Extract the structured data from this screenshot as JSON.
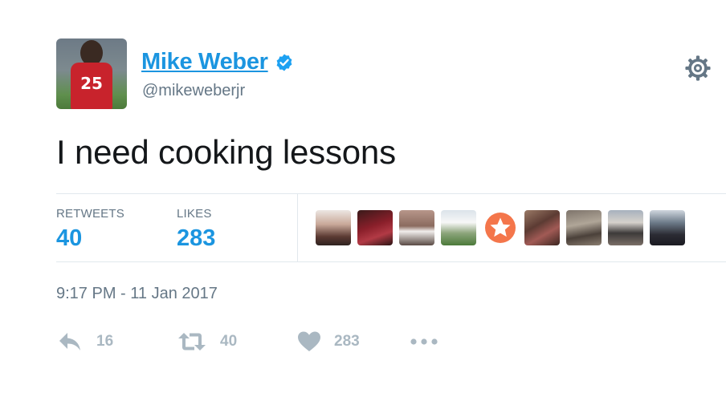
{
  "user": {
    "name": "Mike Weber",
    "handle": "@mikeweberjr",
    "avatar_jersey_number": "25",
    "verified": true
  },
  "tweet": {
    "text": "I need cooking lessons",
    "timestamp": "9:17 PM - 11 Jan 2017"
  },
  "stats": {
    "retweets_label": "RETWEETS",
    "retweets_count": "40",
    "likes_label": "LIKES",
    "likes_count": "283"
  },
  "likers": [
    {
      "icon": "user-avatar"
    },
    {
      "icon": "user-avatar"
    },
    {
      "icon": "user-avatar"
    },
    {
      "icon": "user-avatar"
    },
    {
      "icon": "star-icon"
    },
    {
      "icon": "user-avatar"
    },
    {
      "icon": "user-avatar"
    },
    {
      "icon": "user-avatar"
    },
    {
      "icon": "user-avatar"
    }
  ],
  "actions": {
    "reply_count": "16",
    "retweet_count": "40",
    "like_count": "283"
  },
  "colors": {
    "link_blue": "#1b95e0",
    "secondary_gray": "#657786",
    "action_gray": "#aab8c2",
    "star_orange": "#f4764b"
  }
}
